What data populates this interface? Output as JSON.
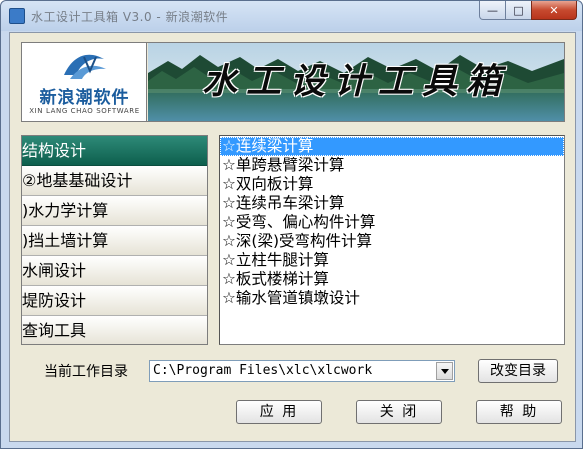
{
  "window": {
    "title": "水工设计工具箱 V3.0 - 新浪潮软件",
    "min_glyph": "—",
    "max_glyph": "□",
    "close_glyph": "✕"
  },
  "banner": {
    "logo_cn": "新浪潮软件",
    "logo_en": "XIN LANG CHAO SOFTWARE",
    "title": "水工设计工具箱"
  },
  "categories": [
    {
      "label": "结构设计",
      "active": true
    },
    {
      "label": "②地基基础设计",
      "active": false
    },
    {
      "label": ")水力学计算",
      "active": false
    },
    {
      "label": ")挡土墙计算",
      "active": false
    },
    {
      "label": "水闸设计",
      "active": false
    },
    {
      "label": "堤防设计",
      "active": false
    },
    {
      "label": "查询工具",
      "active": false
    }
  ],
  "programs": [
    {
      "label": "☆连续梁计算",
      "selected": true
    },
    {
      "label": "☆单跨悬臂梁计算",
      "selected": false
    },
    {
      "label": "☆双向板计算",
      "selected": false
    },
    {
      "label": "☆连续吊车梁计算",
      "selected": false
    },
    {
      "label": "☆受弯、偏心构件计算",
      "selected": false
    },
    {
      "label": "☆深(梁)受弯构件计算",
      "selected": false
    },
    {
      "label": "☆立柱牛腿计算",
      "selected": false
    },
    {
      "label": "☆板式楼梯计算",
      "selected": false
    },
    {
      "label": "☆输水管道镇墩设计",
      "selected": false
    }
  ],
  "workdir": {
    "label": "当前工作目录",
    "value": "C:\\Program Files\\xlc\\xlcwork",
    "change_label": "改变目录"
  },
  "buttons": {
    "apply": "应 用",
    "close": "关 闭",
    "help": "帮 助"
  },
  "colors": {
    "active_category": "#0d5f4d",
    "selection": "#3399ff",
    "brand_blue": "#1c5d9e"
  }
}
